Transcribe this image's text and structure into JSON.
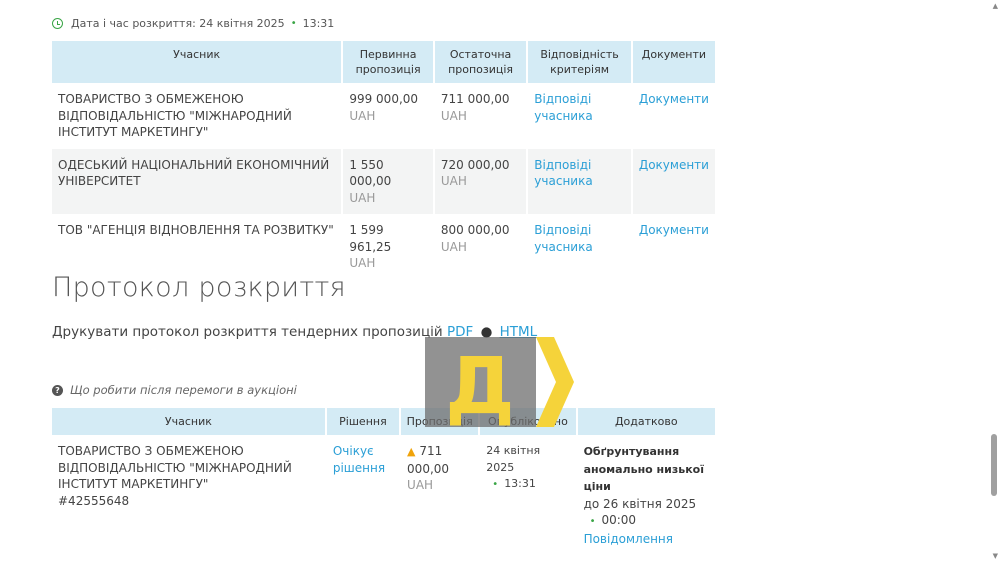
{
  "opening": {
    "label": "Дата і час розкриття: 24 квітня 2025",
    "time": "13:31"
  },
  "bids_table": {
    "headers": [
      "Учасник",
      "Первинна пропозиція",
      "Остаточна пропозиція",
      "Відповідність критеріям",
      "Документи"
    ],
    "rows": [
      {
        "name": "ТОВАРИСТВО З ОБМЕЖЕНОЮ ВІДПОВІДАЛЬНІСТЮ \"МІЖНАРОДНИЙ ІНСТИТУТ МАРКЕТИНГУ\"",
        "initial": "999 000,00",
        "final": "711 000,00",
        "currency": "UAH",
        "criteria": "Відповіді учасника",
        "docs": "Документи"
      },
      {
        "name": "ОДЕСЬКИЙ НАЦІОНАЛЬНИЙ ЕКОНОМІЧНИЙ УНІВЕРСИТЕТ",
        "initial": "1 550 000,00",
        "final": "720 000,00",
        "currency": "UAH",
        "criteria": "Відповіді учасника",
        "docs": "Документи"
      },
      {
        "name": "ТОВ \"АГЕНЦІЯ ВІДНОВЛЕННЯ ТА РОЗВИТКУ\"",
        "initial": "1 599 961,25",
        "final": "800 000,00",
        "currency": "UAH",
        "criteria": "Відповіді учасника",
        "docs": "Документи"
      }
    ]
  },
  "protocol": {
    "title": "Протокол розкриття",
    "print_label": "Друкувати протокол розкриття тендерних пропозицій",
    "pdf": "PDF",
    "separator": "●",
    "html": "HTML"
  },
  "faq_text": "Що робити після перемоги в аукціоні",
  "winner_table": {
    "headers": [
      "Учасник",
      "Рішення",
      "Пропозиція",
      "Опубліковано",
      "Додатково"
    ],
    "row": {
      "name": "ТОВАРИСТВО З ОБМЕЖЕНОЮ ВІДПОВІДАЛЬНІСТЮ \"МІЖНАРОДНИЙ ІНСТИТУТ МАРКЕТИНГУ\"",
      "code": "#42555648",
      "decision": "Очікує рішення",
      "offer": "711 000,00",
      "currency": "UAH",
      "published_date": "24 квітня 2025",
      "published_time": "13:31",
      "extra_title": "Обґрунтування аномально низької ціни",
      "extra_deadline": "до 26 квітня 2025",
      "extra_time": "00:00",
      "extra_link": "Повідомлення"
    }
  },
  "watermark": {
    "letter": "Д",
    "icon": "watermark-logo"
  },
  "colors": {
    "header_bg": "#d4ebf5",
    "link": "#2b9fd6",
    "accent_green": "#3aa546",
    "warning": "#f0a30a",
    "watermark_yellow": "#f5d33a"
  }
}
